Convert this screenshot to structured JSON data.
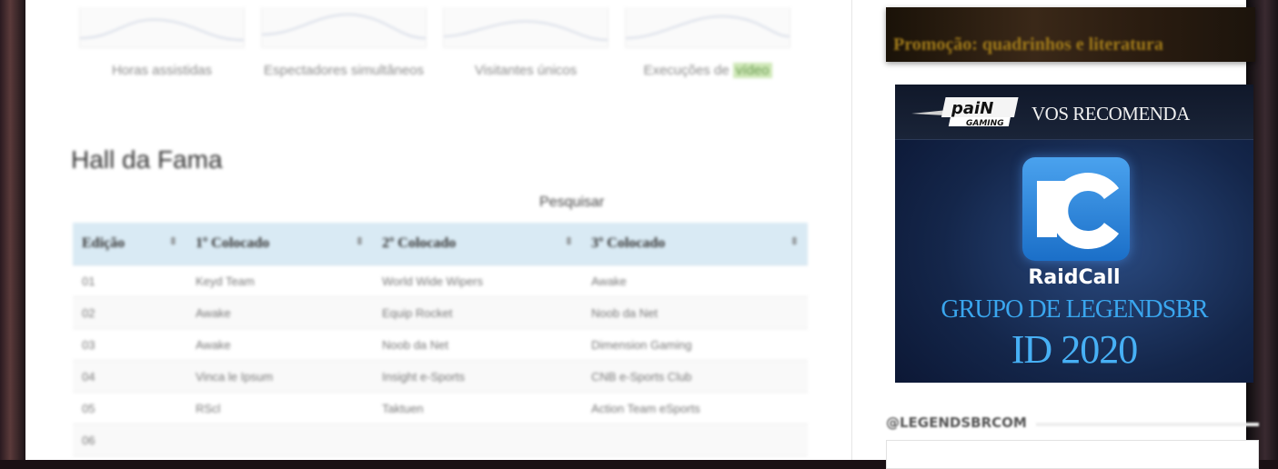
{
  "stats": [
    {
      "label": "Horas assistidas",
      "highlight": ""
    },
    {
      "label": "Espectadores simultâneos",
      "highlight": ""
    },
    {
      "label": "Visitantes únicos",
      "highlight": ""
    },
    {
      "label": "Execuções de ",
      "highlight": "vídeo"
    }
  ],
  "hall": {
    "title": "Hall da Fama",
    "search_label": "Pesquisar",
    "columns": [
      "Edição",
      "1º Colocado",
      "2º Colocado",
      "3º Colocado"
    ],
    "sort_icon": "⇕",
    "rows": [
      [
        "01",
        "Keyd Team",
        "World Wide Wipers",
        "Awake"
      ],
      [
        "02",
        "Awake",
        "Equip Rocket",
        "Noob da Net"
      ],
      [
        "03",
        "Awake",
        "Noob da Net",
        "Dimension Gaming"
      ],
      [
        "04",
        "Vinca le Ipsum",
        "Insight e-Sports",
        "CNB e-Sports Club"
      ],
      [
        "05",
        "RScl",
        "Taktuen",
        "Action Team eSports"
      ],
      [
        "06",
        "",
        "",
        ""
      ]
    ]
  },
  "sidebar": {
    "promo_text": "Promoção: quadrinhos e literatura",
    "ad": {
      "brand": "paiN GAMING",
      "recommends": "VOS RECOMENDA",
      "product": "RaidCall",
      "group": "GRUPO DE LEGENDSBR",
      "id": "ID 2020"
    },
    "twitter_handle": "@LEGENDSBRCOM"
  }
}
